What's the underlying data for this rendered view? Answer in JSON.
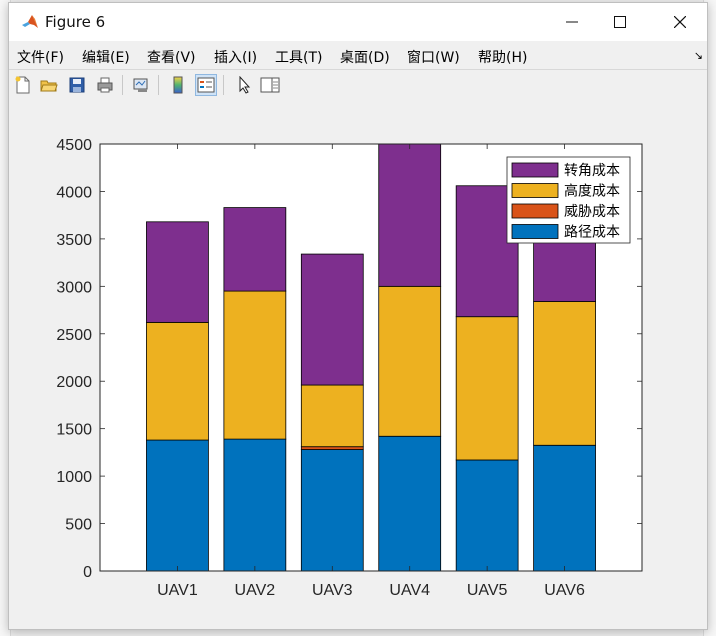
{
  "window": {
    "title": "Figure 6",
    "minimize_glyph": "—",
    "maximize_glyph": "☐",
    "close_glyph": "✕"
  },
  "menu": [
    {
      "label": "文件(F)"
    },
    {
      "label": "编辑(E)"
    },
    {
      "label": "查看(V)"
    },
    {
      "label": "插入(I)"
    },
    {
      "label": "工具(T)"
    },
    {
      "label": "桌面(D)"
    },
    {
      "label": "窗口(W)"
    },
    {
      "label": "帮助(H)"
    }
  ],
  "toolbar": {
    "icons": [
      "new-figure-icon",
      "open-file-icon",
      "save-icon",
      "print-icon",
      "link-plot-icon",
      "insert-colorbar-icon",
      "insert-legend-icon",
      "edit-plot-icon",
      "property-inspector-icon"
    ]
  },
  "colors": {
    "path": "#0072BD",
    "threat": "#D95319",
    "altitude": "#EDB120",
    "turn": "#7E2F8E"
  },
  "chart_data": {
    "type": "bar",
    "stacked": true,
    "categories": [
      "UAV1",
      "UAV2",
      "UAV3",
      "UAV4",
      "UAV5",
      "UAV6"
    ],
    "series": [
      {
        "name": "路径成本",
        "color": "#0072BD",
        "values": [
          1380,
          1390,
          1280,
          1420,
          1170,
          1325
        ]
      },
      {
        "name": "威胁成本",
        "color": "#D95319",
        "values": [
          0,
          0,
          30,
          0,
          0,
          0
        ]
      },
      {
        "name": "高度成本",
        "color": "#EDB120",
        "values": [
          1240,
          1560,
          650,
          1580,
          1510,
          1515
        ]
      },
      {
        "name": "转角成本",
        "color": "#7E2F8E",
        "values": [
          1060,
          880,
          1380,
          1500,
          1380,
          1000
        ]
      }
    ],
    "legend_order": [
      "转角成本",
      "高度成本",
      "威胁成本",
      "路径成本"
    ],
    "yticks": [
      "0",
      "500",
      "1000",
      "1500",
      "2000",
      "2500",
      "3000",
      "3500",
      "4000",
      "4500"
    ],
    "ylim": [
      0,
      4500
    ],
    "legend_position": "top-right",
    "grid": false
  }
}
